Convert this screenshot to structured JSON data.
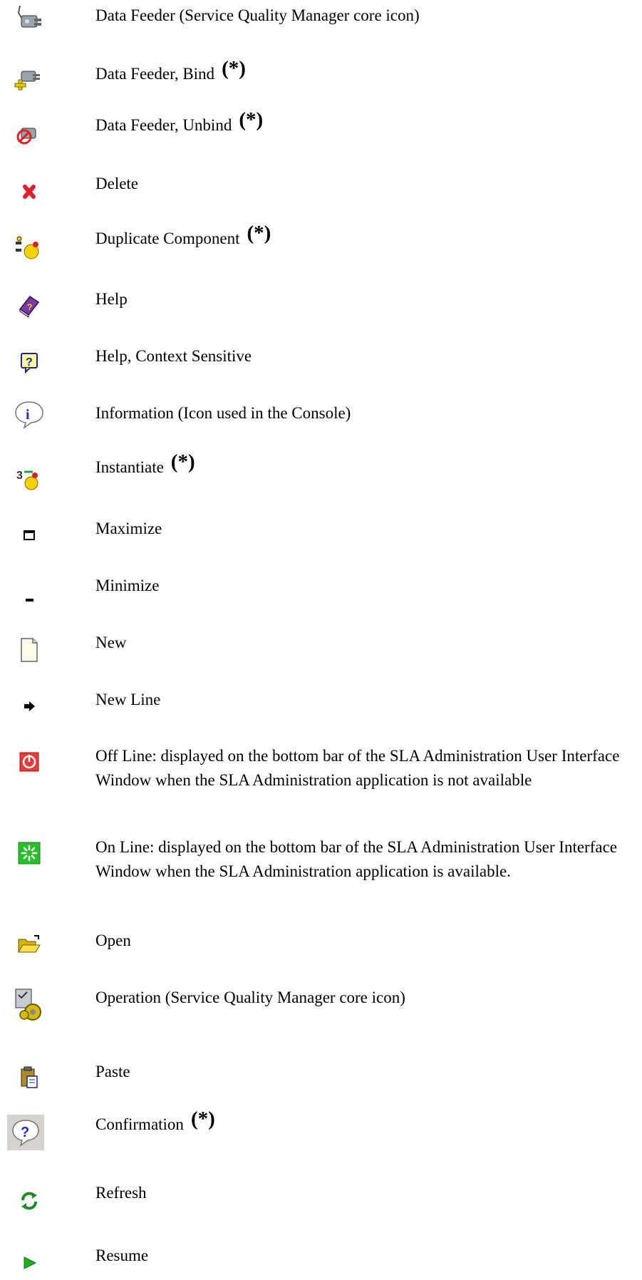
{
  "items": [
    {
      "label": "Data Feeder (Service Quality Manager core icon)",
      "icon": "data-feeder-plug-icon",
      "star": ""
    },
    {
      "label": "Data Feeder, Bind",
      "icon": "data-feeder-bind-icon",
      "star": "(*)"
    },
    {
      "label": "Data Feeder, Unbind",
      "icon": "data-feeder-unbind-icon",
      "star": "(*)"
    },
    {
      "label": "Delete",
      "icon": "delete-x-icon",
      "star": ""
    },
    {
      "label": "Duplicate Component",
      "icon": "duplicate-component-icon",
      "star": "(*)"
    },
    {
      "label": "Help",
      "icon": "help-book-icon",
      "star": ""
    },
    {
      "label": "Help, Context Sensitive",
      "icon": "help-context-icon",
      "star": ""
    },
    {
      "label": "Information (Icon used in the Console)",
      "icon": "information-icon",
      "star": ""
    },
    {
      "label": "Instantiate",
      "icon": "instantiate-icon",
      "star": "(*)"
    },
    {
      "label": "Maximize",
      "icon": "maximize-icon",
      "star": ""
    },
    {
      "label": "Minimize",
      "icon": "minimize-icon",
      "star": ""
    },
    {
      "label": "New",
      "icon": "new-document-icon",
      "star": ""
    },
    {
      "label": "New Line",
      "icon": "new-line-arrow-icon",
      "star": ""
    },
    {
      "label": "Off Line: displayed on the bottom bar of the SLA Administration User Interface Window when the SLA Administration application is not available",
      "icon": "offline-power-icon",
      "star": ""
    },
    {
      "label": "On Line: displayed on the bottom bar of the SLA Administration User Interface Window when the SLA Administration application is available.",
      "icon": "online-status-icon",
      "star": ""
    },
    {
      "label": "Open",
      "icon": "open-folder-icon",
      "star": ""
    },
    {
      "label": "Operation (Service Quality Manager core icon)",
      "icon": "operation-gear-icon",
      "star": ""
    },
    {
      "label": "Paste",
      "icon": "paste-clipboard-icon",
      "star": ""
    },
    {
      "label": "Confirmation",
      "icon": "confirmation-question-icon",
      "star": "(*)"
    },
    {
      "label": "Refresh",
      "icon": "refresh-icon",
      "star": ""
    },
    {
      "label": "Resume",
      "icon": "resume-play-icon",
      "star": ""
    }
  ]
}
